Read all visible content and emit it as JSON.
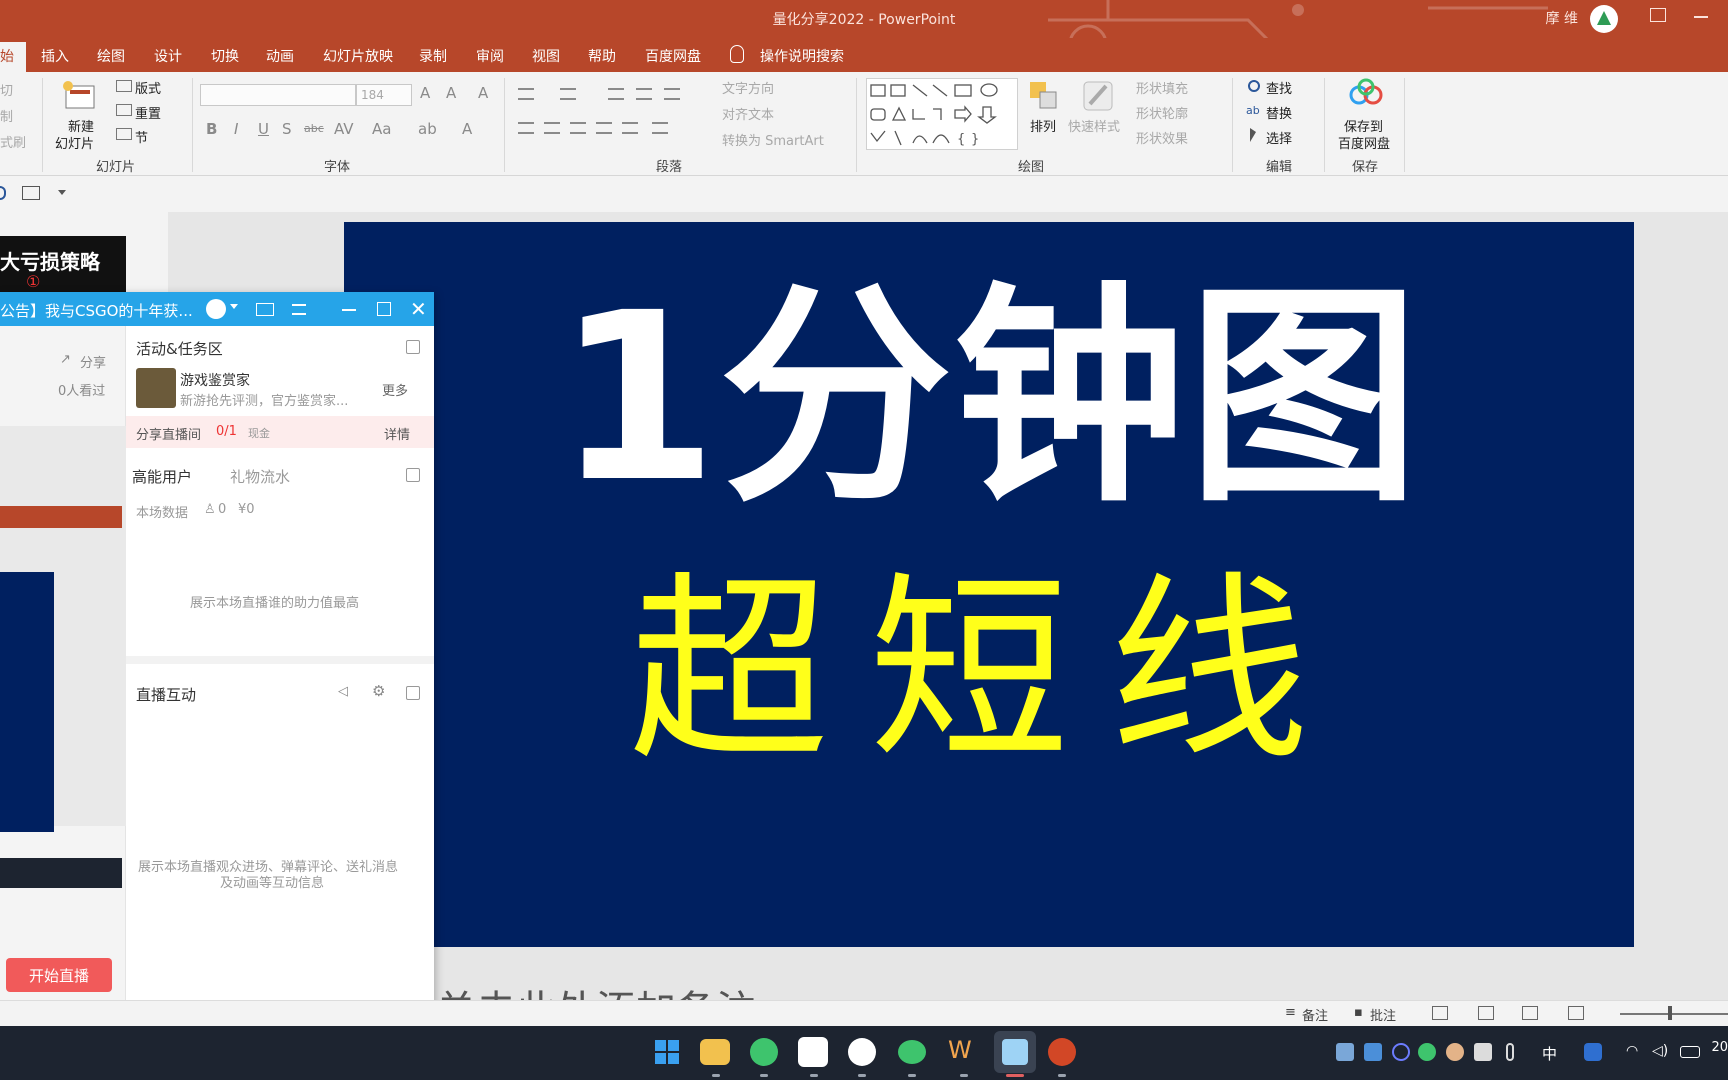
{
  "window": {
    "doc_title": "量化分享2022 - PowerPoint",
    "user_name": "摩 维"
  },
  "ribbon_tabs": [
    "始",
    "插入",
    "绘图",
    "设计",
    "切换",
    "动画",
    "幻灯片放映",
    "录制",
    "审阅",
    "视图",
    "帮助",
    "百度网盘"
  ],
  "tell_me": "操作说明搜索",
  "ribbon": {
    "clipboard_fragments": [
      "切",
      "制",
      "式刷"
    ],
    "slides": {
      "new_slide_line1": "新建",
      "new_slide_line2": "幻灯片",
      "layout": "版式",
      "reset": "重置",
      "section": "节",
      "group": "幻灯片"
    },
    "font": {
      "size": "184",
      "group": "字体"
    },
    "paragraph": {
      "text_direction": "文字方向",
      "align_text": "对齐文本",
      "smartart": "转换为 SmartArt",
      "group": "段落"
    },
    "drawing": {
      "arrange": "排列",
      "quick_styles": "快速样式",
      "shape_fill": "形状填充",
      "shape_outline": "形状轮廓",
      "shape_effects": "形状效果",
      "group": "绘图"
    },
    "editing": {
      "find": "查找",
      "replace": "替换",
      "select": "选择",
      "group": "编辑"
    },
    "save": {
      "label_line1": "保存到",
      "label_line2": "百度网盘",
      "group": "保存"
    }
  },
  "thumbnail": {
    "text": "大亏损策略",
    "marker": "①"
  },
  "slide": {
    "line1": "1分钟图",
    "line2": "超短线"
  },
  "notes_text": "单击此处添加备注",
  "stream_window": {
    "title": "公告】我与CSGO的十年获...",
    "share": "分享",
    "viewers": "0人看过",
    "activity": {
      "title": "活动&任务区",
      "game_name": "游戏鉴赏家",
      "game_desc": "新游抢先评测，官方鉴赏家...",
      "more": "更多"
    },
    "share_room": {
      "label": "分享直播间",
      "progress": "0/1",
      "reward": "现金",
      "detail": "详情"
    },
    "high_energy": {
      "tab_users": "高能用户",
      "tab_gifts": "礼物流水",
      "stats_label": "本场数据",
      "stat_people": "0",
      "stat_money": "¥0",
      "empty_hint": "展示本场直播谁的助力值最高"
    },
    "interaction": {
      "title": "直播互动",
      "empty_hint_line1": "展示本场直播观众进场、弹幕评论、送礼消息",
      "empty_hint_line2": "及动画等互动信息"
    },
    "start_button": "开始直播"
  },
  "statusbar": {
    "notes": "备注",
    "comments": "批注"
  },
  "taskbar": {
    "ime": "中",
    "clock": "20"
  },
  "colors": {
    "ppt_red": "#b7472a",
    "slide_bg": "#002060",
    "slide_white": "#ffffff",
    "slide_yellow": "#ffff1a",
    "stream_blue": "#26a4e8",
    "start_red": "#f15a5a"
  }
}
